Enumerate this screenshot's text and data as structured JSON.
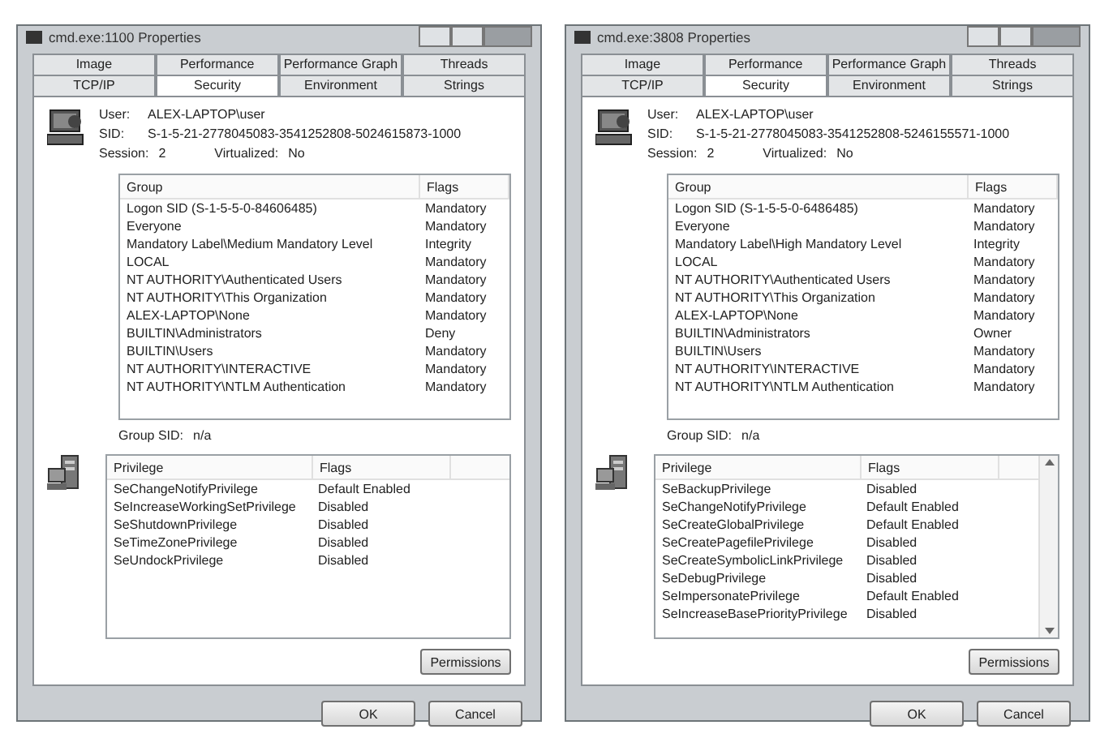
{
  "windows": [
    {
      "title": "cmd.exe:1100 Properties",
      "tab_rows": [
        [
          {
            "label": "Image",
            "selected": false
          },
          {
            "label": "Performance",
            "selected": false
          },
          {
            "label": "Performance Graph",
            "selected": false
          },
          {
            "label": "Threads",
            "selected": false
          }
        ],
        [
          {
            "label": "TCP/IP",
            "selected": false
          },
          {
            "label": "Security",
            "selected": true
          },
          {
            "label": "Environment",
            "selected": false
          },
          {
            "label": "Strings",
            "selected": false
          }
        ]
      ],
      "user_label": "User:",
      "user": "ALEX-LAPTOP\\user",
      "sid_label": "SID:",
      "sid": "S-1-5-21-2778045083-3541252808-5024615873-1000",
      "session_label": "Session:",
      "session": "2",
      "virtualized_label": "Virtualized:",
      "virtualized": "No",
      "groups": {
        "columns": [
          "Group",
          "Flags"
        ],
        "rows": [
          {
            "group": "Logon SID (S-1-5-5-0-84606485)",
            "flags": "Mandatory"
          },
          {
            "group": "Everyone",
            "flags": "Mandatory"
          },
          {
            "group": "Mandatory Label\\Medium Mandatory Level",
            "flags": "Integrity"
          },
          {
            "group": "LOCAL",
            "flags": "Mandatory"
          },
          {
            "group": "NT AUTHORITY\\Authenticated Users",
            "flags": "Mandatory"
          },
          {
            "group": "NT AUTHORITY\\This Organization",
            "flags": "Mandatory"
          },
          {
            "group": "ALEX-LAPTOP\\None",
            "flags": "Mandatory"
          },
          {
            "group": "BUILTIN\\Administrators",
            "flags": "Deny"
          },
          {
            "group": "BUILTIN\\Users",
            "flags": "Mandatory"
          },
          {
            "group": "NT AUTHORITY\\INTERACTIVE",
            "flags": "Mandatory"
          },
          {
            "group": "NT AUTHORITY\\NTLM Authentication",
            "flags": "Mandatory"
          }
        ]
      },
      "group_sid_label": "Group SID:",
      "group_sid": "n/a",
      "privileges": {
        "columns": [
          "Privilege",
          "Flags"
        ],
        "scrollable": false,
        "rows": [
          {
            "privilege": "SeChangeNotifyPrivilege",
            "flags": "Default Enabled"
          },
          {
            "privilege": "SeIncreaseWorkingSetPrivilege",
            "flags": "Disabled"
          },
          {
            "privilege": "SeShutdownPrivilege",
            "flags": "Disabled"
          },
          {
            "privilege": "SeTimeZonePrivilege",
            "flags": "Disabled"
          },
          {
            "privilege": "SeUndockPrivilege",
            "flags": "Disabled"
          }
        ]
      },
      "permissions_button": "Permissions",
      "ok_button": "OK",
      "cancel_button": "Cancel"
    },
    {
      "title": "cmd.exe:3808 Properties",
      "tab_rows": [
        [
          {
            "label": "Image",
            "selected": false
          },
          {
            "label": "Performance",
            "selected": false
          },
          {
            "label": "Performance Graph",
            "selected": false
          },
          {
            "label": "Threads",
            "selected": false
          }
        ],
        [
          {
            "label": "TCP/IP",
            "selected": false
          },
          {
            "label": "Security",
            "selected": true
          },
          {
            "label": "Environment",
            "selected": false
          },
          {
            "label": "Strings",
            "selected": false
          }
        ]
      ],
      "user_label": "User:",
      "user": "ALEX-LAPTOP\\user",
      "sid_label": "SID:",
      "sid": "S-1-5-21-2778045083-3541252808-5246155571-1000",
      "session_label": "Session:",
      "session": "2",
      "virtualized_label": "Virtualized:",
      "virtualized": "No",
      "groups": {
        "columns": [
          "Group",
          "Flags"
        ],
        "rows": [
          {
            "group": "Logon SID (S-1-5-5-0-6486485)",
            "flags": "Mandatory"
          },
          {
            "group": "Everyone",
            "flags": "Mandatory"
          },
          {
            "group": "Mandatory Label\\High Mandatory Level",
            "flags": "Integrity"
          },
          {
            "group": "LOCAL",
            "flags": "Mandatory"
          },
          {
            "group": "NT AUTHORITY\\Authenticated Users",
            "flags": "Mandatory"
          },
          {
            "group": "NT AUTHORITY\\This Organization",
            "flags": "Mandatory"
          },
          {
            "group": "ALEX-LAPTOP\\None",
            "flags": "Mandatory"
          },
          {
            "group": "BUILTIN\\Administrators",
            "flags": "Owner"
          },
          {
            "group": "BUILTIN\\Users",
            "flags": "Mandatory"
          },
          {
            "group": "NT AUTHORITY\\INTERACTIVE",
            "flags": "Mandatory"
          },
          {
            "group": "NT AUTHORITY\\NTLM Authentication",
            "flags": "Mandatory"
          }
        ]
      },
      "group_sid_label": "Group SID:",
      "group_sid": "n/a",
      "privileges": {
        "columns": [
          "Privilege",
          "Flags"
        ],
        "scrollable": true,
        "rows": [
          {
            "privilege": "SeBackupPrivilege",
            "flags": "Disabled"
          },
          {
            "privilege": "SeChangeNotifyPrivilege",
            "flags": "Default Enabled"
          },
          {
            "privilege": "SeCreateGlobalPrivilege",
            "flags": "Default Enabled"
          },
          {
            "privilege": "SeCreatePagefilePrivilege",
            "flags": "Disabled"
          },
          {
            "privilege": "SeCreateSymbolicLinkPrivilege",
            "flags": "Disabled"
          },
          {
            "privilege": "SeDebugPrivilege",
            "flags": "Disabled"
          },
          {
            "privilege": "SeImpersonatePrivilege",
            "flags": "Default Enabled"
          },
          {
            "privilege": "SeIncreaseBasePriorityPrivilege",
            "flags": "Disabled"
          }
        ]
      },
      "permissions_button": "Permissions",
      "ok_button": "OK",
      "cancel_button": "Cancel"
    }
  ]
}
